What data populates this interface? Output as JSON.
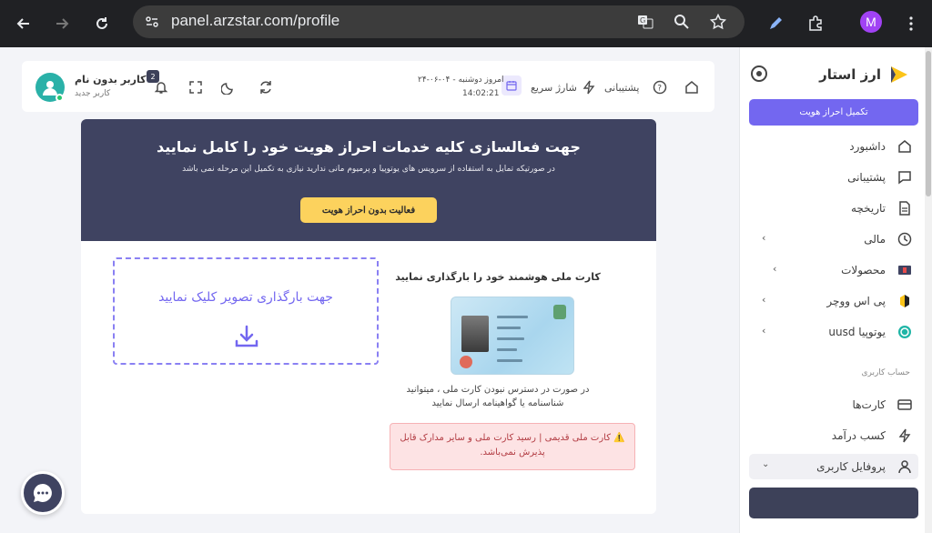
{
  "browser": {
    "url": "panel.arzstar.com/profile",
    "profile_initial": "M"
  },
  "sidebar": {
    "brand_name": "ارز استار",
    "kyc_button": "تکمیل احراز هویت",
    "items": [
      {
        "label": "داشبورد",
        "icon": "home-icon"
      },
      {
        "label": "پشتیبانی",
        "icon": "chat-icon"
      },
      {
        "label": "تاریخچه",
        "icon": "document-icon"
      },
      {
        "label": "مالی",
        "icon": "clock-icon"
      },
      {
        "label": "محصولات",
        "icon": "gift-card-icon"
      },
      {
        "label": "پی اس ووچر",
        "icon": "psvoucher-icon"
      },
      {
        "label": "یوتوپیا uusd",
        "icon": "utopia-icon"
      }
    ],
    "section_label": "حساب کاربری",
    "account_items": [
      {
        "label": "کارت‌ها",
        "icon": "card-icon"
      },
      {
        "label": "کسب درآمد",
        "icon": "bolt-icon"
      },
      {
        "label": "پروفایل کاربری",
        "icon": "user-icon"
      }
    ],
    "accent": "#7367f0"
  },
  "header": {
    "home_icon": "home-icon",
    "support_label": "پشتیبانی",
    "recharge_label": "شارژ سریع",
    "date_label": "امروز دوشنبه - ۰۴-۰۶-۲۴",
    "time_label": "14:02:21",
    "notification_count": "2",
    "user_name": "کاربر بدون نام",
    "user_role": "کاربر جدید"
  },
  "banner": {
    "title": "جهت فعالسازی کلیه خدمات احراز هویت خود را کامل نمایید",
    "subtitle": "در صورتیکه تمایل به استفاده از سرویس های یوتوپیا و پرمیوم مانی ندارید نیازی به تکمیل این مرحله نمی باشد",
    "button": "فعالیت بدون احراز هویت",
    "bg": "#3f4361",
    "button_color": "#fcd25d"
  },
  "upload": {
    "text": "جهت بارگذاری تصویر کلیک نمایید"
  },
  "id_section": {
    "title": "کارت ملی هوشمند خود را بارگذاری نمایید",
    "description": "در صورت در دسترس نبودن کارت ملی ، میتوانید شناسنامه یا گواهینامه ارسال نمایید",
    "warning": "⚠️ کارت ملی قدیمی | رسید کارت ملی و سایر مدارک قابل پذیرش نمی‌باشد."
  }
}
